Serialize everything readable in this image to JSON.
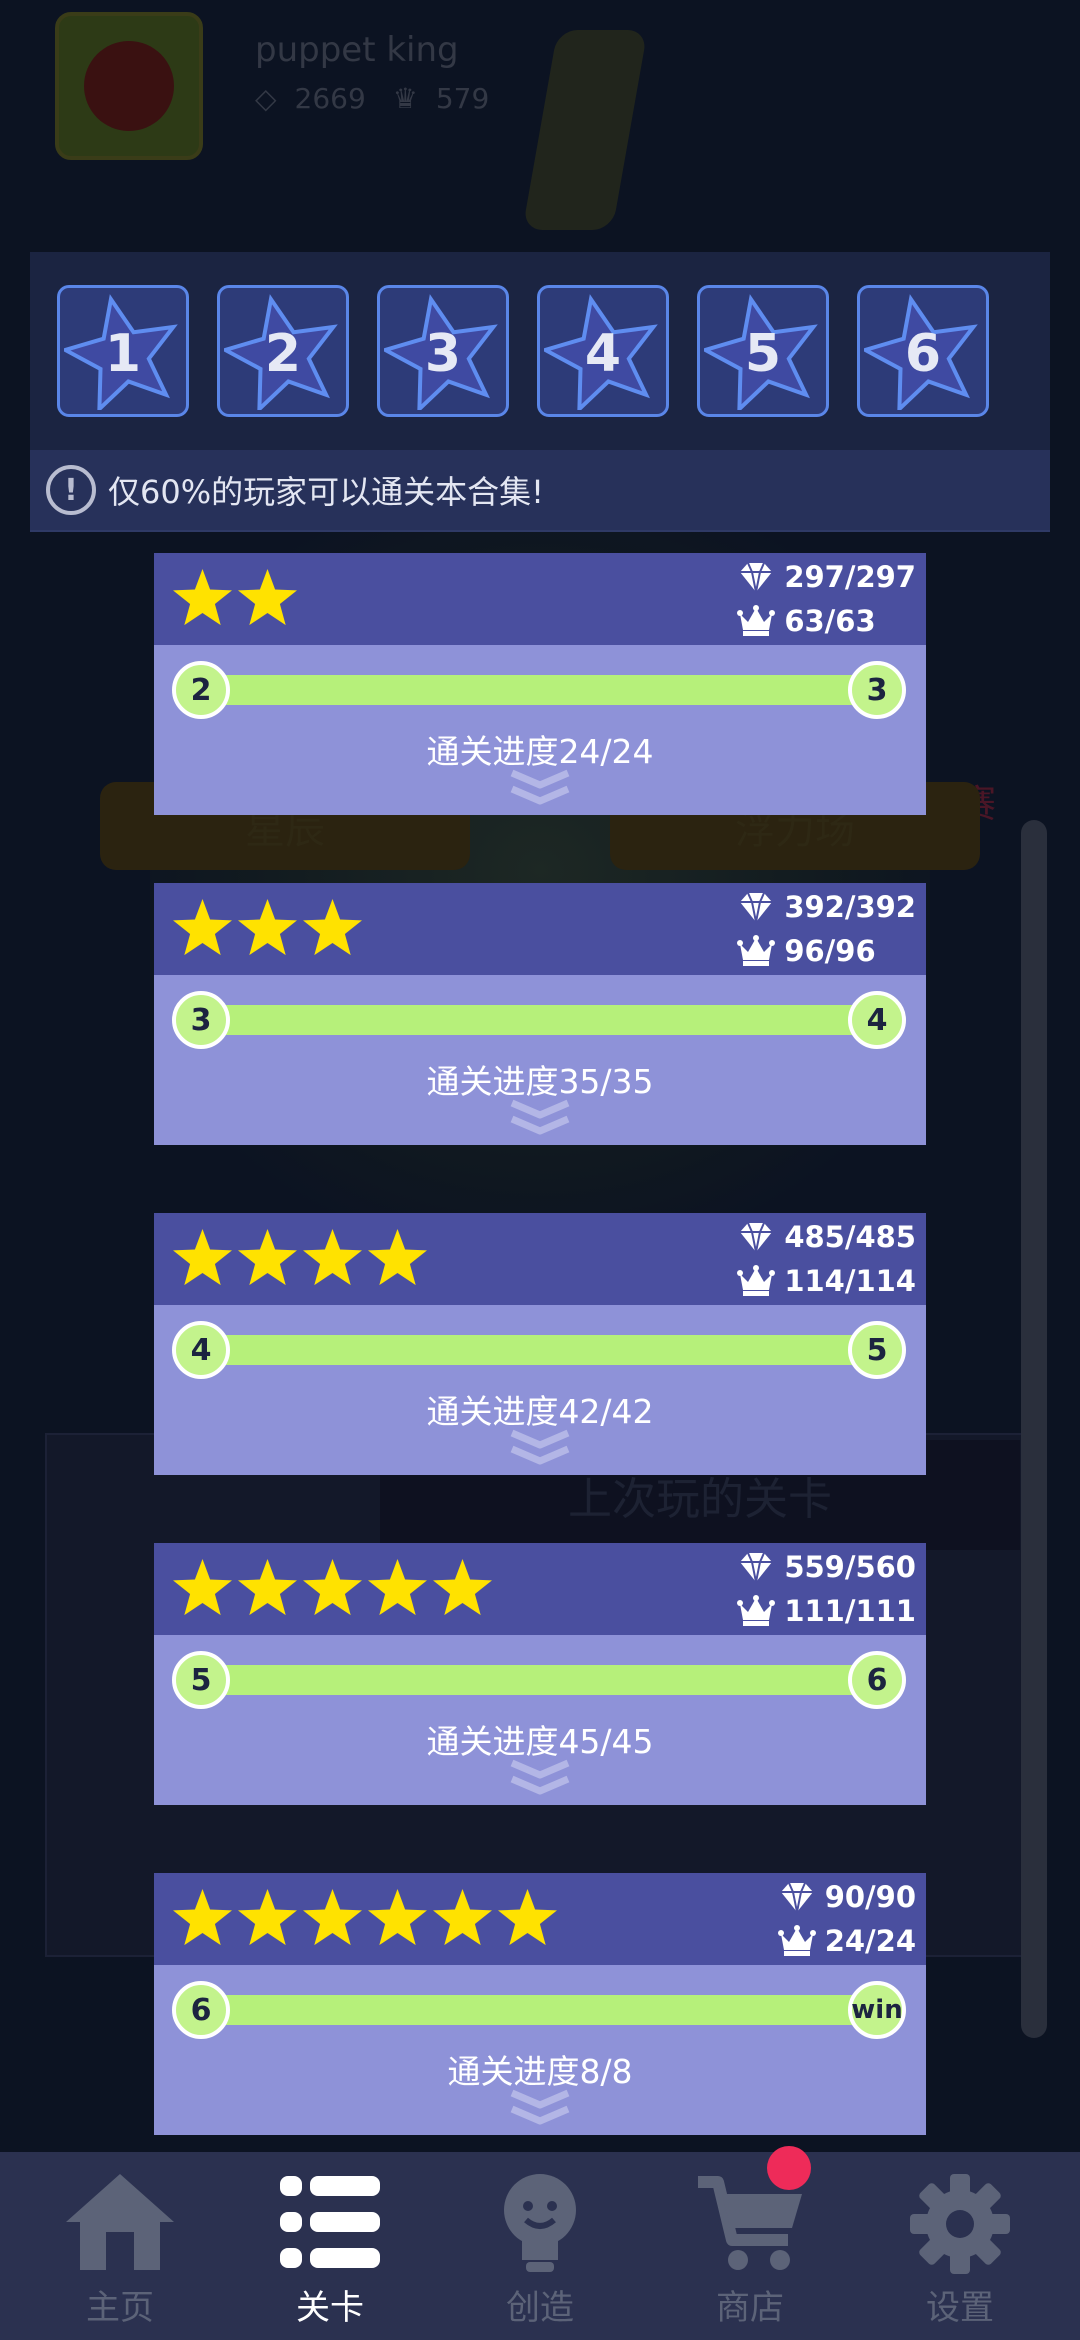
{
  "background": {
    "profile": {
      "name": "puppet king",
      "gems": "2669",
      "crowns": "579"
    },
    "tag_left": "星辰",
    "tag_right": "浮力场",
    "red_text": "画赛",
    "last_played_title": "上次玩的关卡"
  },
  "level_selector": {
    "levels": [
      "1",
      "2",
      "3",
      "4",
      "5",
      "6"
    ],
    "hint_icon": "!",
    "hint_text": "仅60%的玩家可以通关本合集!"
  },
  "stages": [
    {
      "stars": 2,
      "gems": "297/297",
      "crowns": "63/63",
      "from": "2",
      "to": "3",
      "progress_text": "通关进度24/24",
      "progress": 1.0
    },
    {
      "stars": 3,
      "gems": "392/392",
      "crowns": "96/96",
      "from": "3",
      "to": "4",
      "progress_text": "通关进度35/35",
      "progress": 1.0
    },
    {
      "stars": 4,
      "gems": "485/485",
      "crowns": "114/114",
      "from": "4",
      "to": "5",
      "progress_text": "通关进度42/42",
      "progress": 1.0
    },
    {
      "stars": 5,
      "gems": "559/560",
      "crowns": "111/111",
      "from": "5",
      "to": "6",
      "progress_text": "通关进度45/45",
      "progress": 1.0
    },
    {
      "stars": 6,
      "gems": "90/90",
      "crowns": "24/24",
      "from": "6",
      "to": "win",
      "progress_text": "通关进度8/8",
      "progress": 1.0
    }
  ],
  "nav": {
    "items": [
      {
        "label": "主页",
        "icon": "home-icon"
      },
      {
        "label": "关卡",
        "icon": "levels-list-icon"
      },
      {
        "label": "创造",
        "icon": "lightbulb-icon"
      },
      {
        "label": "商店",
        "icon": "cart-icon"
      },
      {
        "label": "设置",
        "icon": "gear-icon"
      }
    ],
    "active_index": 1
  },
  "colors": {
    "card_header": "#4a4f9f",
    "card_body": "#8e92d8",
    "progress_green": "#b6f07a",
    "star_yellow": "#ffe200",
    "badge_red": "#ee2b59"
  }
}
